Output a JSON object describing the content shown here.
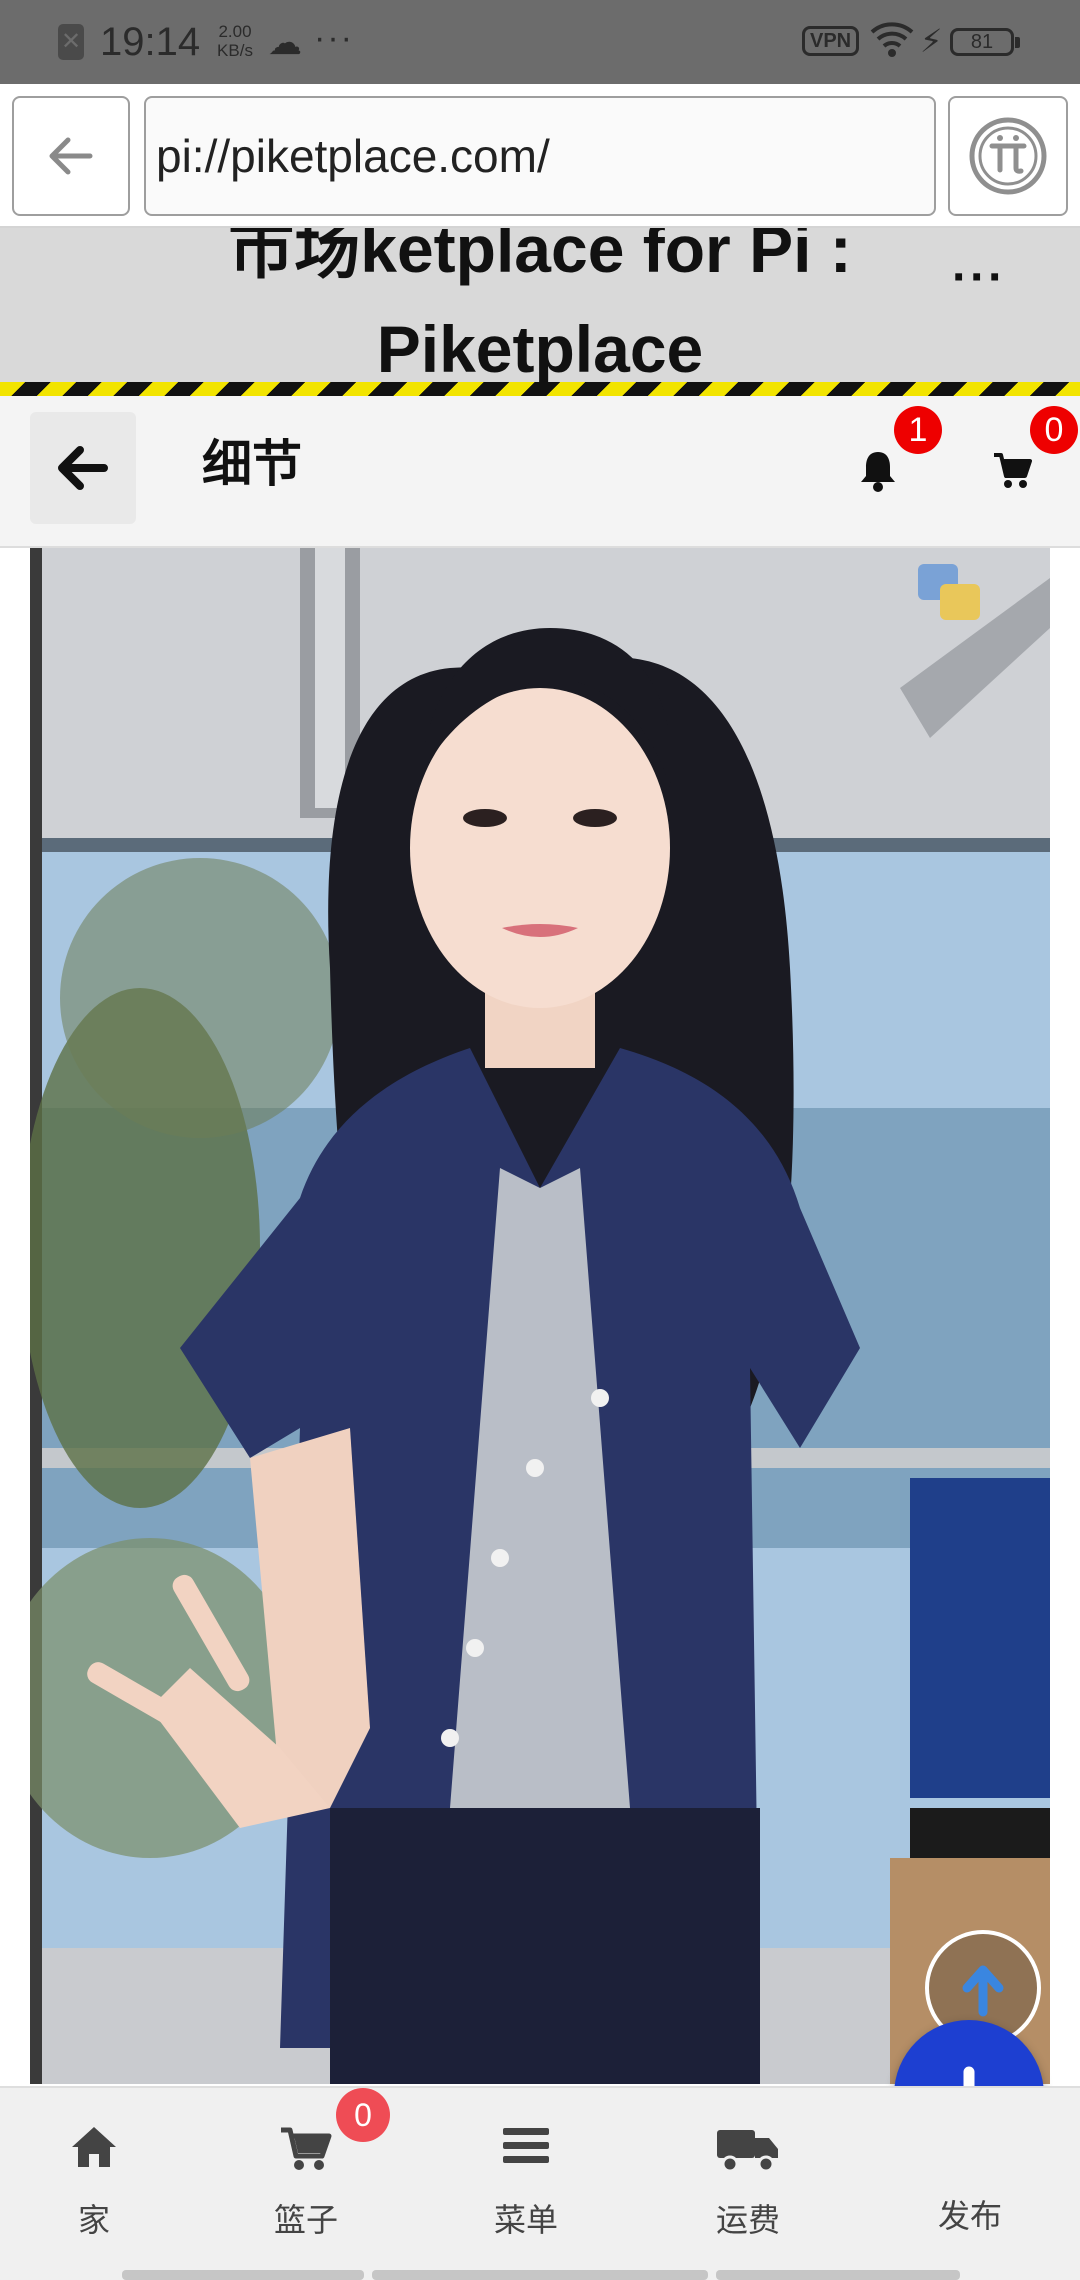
{
  "status_bar": {
    "time": "19:14",
    "speed_value": "2.00",
    "speed_unit": "KB/s",
    "more_indicator": "···",
    "vpn_label": "VPN",
    "battery_level": "81",
    "icons": [
      "notification-blocked-icon",
      "cloud-icon",
      "wifi-icon",
      "charging-icon",
      "battery-icon"
    ]
  },
  "browser": {
    "url": "pi://piketplace.com/",
    "icons": [
      "back-arrow-icon",
      "pi-logo-icon"
    ]
  },
  "page_title": {
    "line1": "市场ketplace for Pi :",
    "line2": "Piketplace",
    "more_label": "···"
  },
  "app_header": {
    "title": "细节",
    "notification_count": "1",
    "cart_count": "0",
    "icons": [
      "back-arrow-icon",
      "bell-icon",
      "cart-icon"
    ]
  },
  "floating": {
    "icons": [
      "arrow-up-icon",
      "plus-icon"
    ]
  },
  "bottom_nav": {
    "items": [
      {
        "label": "家",
        "icon": "home-icon"
      },
      {
        "label": "篮子",
        "icon": "cart-icon"
      },
      {
        "label": "菜单",
        "icon": "menu-icon"
      },
      {
        "label": "运费",
        "icon": "truck-icon"
      },
      {
        "label": "发布",
        "icon": "publish-icon"
      }
    ],
    "basket_count": "0"
  },
  "colors": {
    "status_bar_bg": "#6c6c6c",
    "banner_bg": "#d9d9d9",
    "hazard_yellow": "#f2e400",
    "badge_red": "#ee0000",
    "fab_blue": "#1d3fd1",
    "nav_bg": "#f0f0f0"
  }
}
